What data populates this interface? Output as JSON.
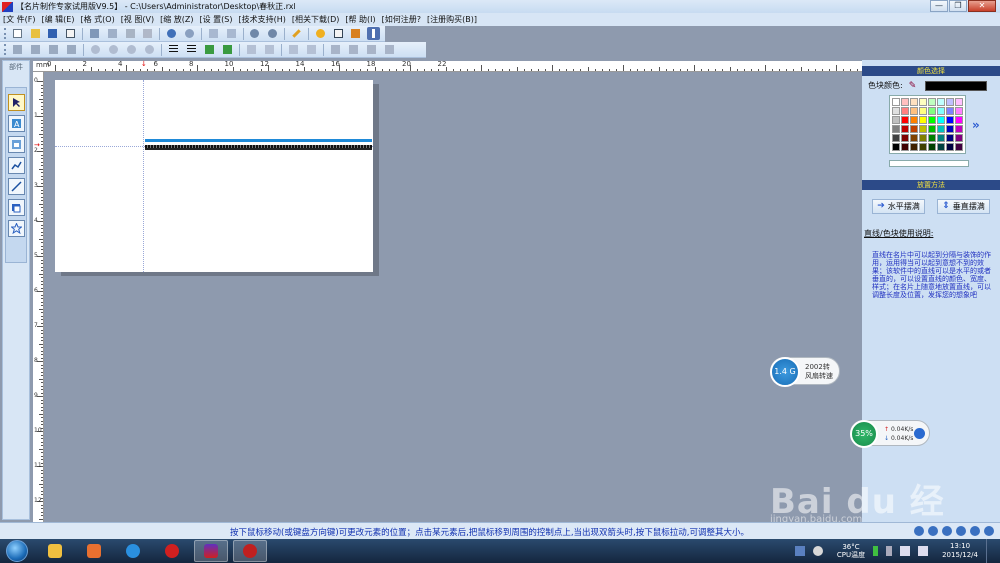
{
  "window": {
    "title": "【名片制作专家试用版V9.5】 - C:\\Users\\Administrator\\Desktop\\春秋正.rxl",
    "minimize": "—",
    "maximize": "❐",
    "close": "✕"
  },
  "menu": [
    "[文 件(F)",
    "[编 辑(E)",
    "[格 式(O)",
    "[视 图(V)",
    "[缩 放(Z)",
    "[设 置(S)",
    "[技术支持(H)",
    "[相关下载(D)",
    "[帮 助(I)",
    "[如何注册?",
    "[注册购买(B)]"
  ],
  "toolbar1_icons": [
    "new-file-icon",
    "open-folder-icon",
    "save-icon",
    "print-preview-icon",
    "cut-icon",
    "copy-icon",
    "paste-icon",
    "delete-icon",
    "undo-icon",
    "redo-icon",
    "layer-up-icon",
    "layer-down-icon",
    "zoom-in-icon",
    "zoom-out-icon",
    "pencil-icon",
    "help-icon",
    "register-icon",
    "tools-icon",
    "scroll-icon"
  ],
  "toolbar2_icons": [
    "align-left-icon",
    "align-center-icon",
    "align-right-icon",
    "align-top-icon",
    "move-up-icon",
    "move-down-icon",
    "move-left-icon",
    "move-right-icon",
    "justify-left-icon",
    "justify-center-icon",
    "justify-right-icon",
    "group-icon",
    "ungroup-icon",
    "grid-icon",
    "table-icon",
    "first-icon",
    "prev-icon",
    "next-icon",
    "last-icon",
    "frame-icon"
  ],
  "parts_panel": {
    "title": "部件",
    "tools": [
      "select-arrow-icon",
      "text-tool-icon",
      "image-tool-icon",
      "line-chart-tool-icon",
      "line-tool-icon",
      "rectangle-tool-icon",
      "star-shape-icon"
    ]
  },
  "ruler": {
    "unit": "mm",
    "top_labels": [
      "0",
      "2",
      "4",
      "6",
      "8",
      "10",
      "12",
      "14",
      "16",
      "18",
      "20",
      "22"
    ],
    "left_labels": [
      "0",
      "1",
      "2",
      "3",
      "4",
      "5",
      "6",
      "7",
      "8",
      "9",
      "10",
      "11",
      "12"
    ]
  },
  "colors": {
    "blue_line": "#1f8ad8",
    "canvas_bg": "#8e9aae",
    "panel_header": "#2c4a88",
    "selected_color": "#000000"
  },
  "color_panel": {
    "header": "颜色选择",
    "label": "色块颜色:",
    "palette": [
      "#ffffff",
      "#ffc0c0",
      "#ffe0c0",
      "#ffffc0",
      "#c0ffc0",
      "#c0ffff",
      "#c0c0ff",
      "#ffc0ff",
      "#e0e0e0",
      "#ff8080",
      "#ffc080",
      "#ffff80",
      "#80ff80",
      "#80ffff",
      "#8080ff",
      "#ff80ff",
      "#c0c0c0",
      "#ff0000",
      "#ff8000",
      "#ffff00",
      "#00ff00",
      "#00ffff",
      "#0000ff",
      "#ff00ff",
      "#808080",
      "#c00000",
      "#c04000",
      "#c0c000",
      "#00c000",
      "#00c0c0",
      "#0000c0",
      "#c000c0",
      "#404040",
      "#800000",
      "#804000",
      "#808000",
      "#008000",
      "#008080",
      "#000080",
      "#800080",
      "#000000",
      "#400000",
      "#402000",
      "#404000",
      "#004000",
      "#004040",
      "#000040",
      "#400040"
    ],
    "more": "»"
  },
  "placement": {
    "header": "放置方法",
    "horizontal": "水平摆满",
    "vertical": "垂直摆满"
  },
  "usage": {
    "title": "直线/色块使用说明:",
    "text": "直线在名片中可以起到分隔与装饰的作用，运用得当可以起到意想不到的效果；该软件中的直线可以是水平的或者垂直的，可以设置直线的颜色、宽度、样式；在名片上随意地放置直线，可以调整长度及位置，发挥您的想象吧"
  },
  "status": {
    "text": "按下鼠标移动(或键盘方向键)可更改元素的位置；点击某元素后,把鼠标移到周围的控制点上,当出现双箭头时,按下鼠标拉动,可调整其大小。"
  },
  "fan_widget": {
    "value": "1.4 G",
    "rpm": "2002转",
    "label": "风扇转速"
  },
  "net_widget": {
    "percent": "35%",
    "up": "0.04K/s",
    "down": "0.04K/s"
  },
  "watermark": {
    "big": "Bai du 经验",
    "small": "jingyan.baidu.com"
  },
  "taskbar": {
    "apps": [
      "file-explorer-icon",
      "media-player-icon",
      "video-player-icon",
      "opera-browser-icon",
      "card-maker-icon",
      "tool-app-icon"
    ],
    "temp": "36°C",
    "temp_label": "CPU温度",
    "time": "13:10",
    "date": "2015/12/4"
  }
}
